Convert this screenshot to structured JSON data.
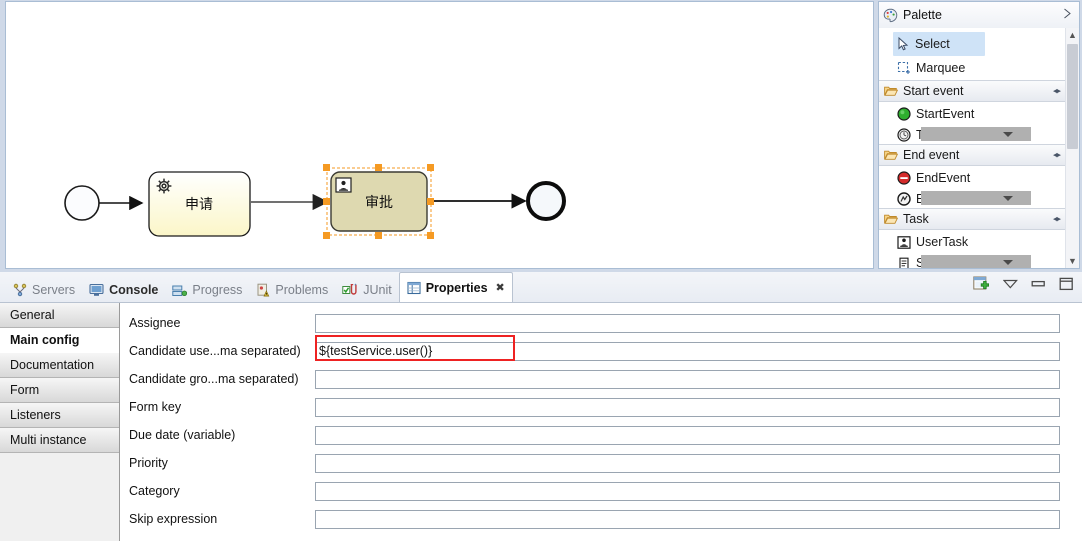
{
  "editor": {
    "diagram": {
      "start_event": {
        "name": "start-event",
        "shape": "circle"
      },
      "end_event": {
        "name": "end-event",
        "shape": "circle-thick"
      },
      "tasks": [
        {
          "label": "申请",
          "type": "service-task",
          "icon": "gear-icon",
          "selected": false,
          "fill_top": "#ffffff",
          "fill_bottom": "#fbf8d0"
        },
        {
          "label": "审批",
          "type": "user-task",
          "icon": "user-task-icon",
          "selected": true,
          "fill": "#ded9b0"
        }
      ],
      "selection_handle_color": "#f59a23"
    }
  },
  "palette": {
    "title": "Palette",
    "title_icon": "palette-icon",
    "expand_icon": "chevron-right-icon",
    "groups": [
      {
        "name": "",
        "header": false,
        "items": [
          {
            "label": "Select",
            "icon": "cursor-icon",
            "selected": true
          },
          {
            "label": "Marquee",
            "icon": "marquee-icon",
            "selected": false
          }
        ]
      },
      {
        "name": "Start event",
        "header": true,
        "icon": "folder-open-icon",
        "toggle_icon": "collapse-icon",
        "items": [
          {
            "label": "StartEvent",
            "icon": "start-event-icon",
            "clipped": false
          },
          {
            "label": "TimerStartEvent",
            "icon": "timer-start-event-icon",
            "clipped": true
          }
        ]
      },
      {
        "name": "End event",
        "header": true,
        "icon": "folder-open-icon",
        "toggle_icon": "collapse-icon",
        "items": [
          {
            "label": "EndEvent",
            "icon": "end-event-icon",
            "clipped": false
          },
          {
            "label": "ErrorEndEvent",
            "icon": "error-end-event-icon",
            "clipped": true
          }
        ]
      },
      {
        "name": "Task",
        "header": true,
        "icon": "folder-open-icon",
        "toggle_icon": "collapse-icon",
        "items": [
          {
            "label": "UserTask",
            "icon": "user-task-icon",
            "clipped": false
          },
          {
            "label": "ScriptTask",
            "icon": "script-task-icon",
            "clipped": true
          }
        ]
      }
    ]
  },
  "bottom_panel": {
    "tabs": [
      {
        "label": "Servers",
        "icon": "servers-icon",
        "active": false,
        "bold": false
      },
      {
        "label": "Console",
        "icon": "console-icon",
        "active": false,
        "bold": true
      },
      {
        "label": "Progress",
        "icon": "progress-icon",
        "active": false,
        "bold": false
      },
      {
        "label": "Problems",
        "icon": "problems-icon",
        "active": false,
        "bold": false
      },
      {
        "label": "JUnit",
        "icon": "junit-icon",
        "active": false,
        "bold": false
      },
      {
        "label": "Properties",
        "icon": "properties-icon",
        "active": true,
        "bold": true,
        "close_icon": "close-icon"
      }
    ],
    "toolbar": [
      {
        "name": "pin-view-icon",
        "label": "New Properties View"
      },
      {
        "name": "view-menu-icon",
        "label": "View Menu"
      },
      {
        "name": "minimize-icon",
        "label": "Minimize"
      },
      {
        "name": "maximize-icon",
        "label": "Maximize"
      }
    ]
  },
  "properties": {
    "sidebar": [
      {
        "label": "General",
        "active": false
      },
      {
        "label": "Main config",
        "active": true
      },
      {
        "label": "Documentation",
        "active": false
      },
      {
        "label": "Form",
        "active": false
      },
      {
        "label": "Listeners",
        "active": false
      },
      {
        "label": "Multi instance",
        "active": false
      }
    ],
    "fields": [
      {
        "label": "Assignee",
        "value": "",
        "highlighted": false
      },
      {
        "label": "Candidate use...ma separated)",
        "value": "${testService.user()}",
        "highlighted": true
      },
      {
        "label": "Candidate gro...ma separated)",
        "value": "",
        "highlighted": false
      },
      {
        "label": "Form key",
        "value": "",
        "highlighted": false
      },
      {
        "label": "Due date (variable)",
        "value": "",
        "highlighted": false
      },
      {
        "label": "Priority",
        "value": "",
        "highlighted": false
      },
      {
        "label": "Category",
        "value": "",
        "highlighted": false
      },
      {
        "label": "Skip expression",
        "value": "",
        "highlighted": false
      }
    ],
    "highlight_color": "#ee2222"
  }
}
